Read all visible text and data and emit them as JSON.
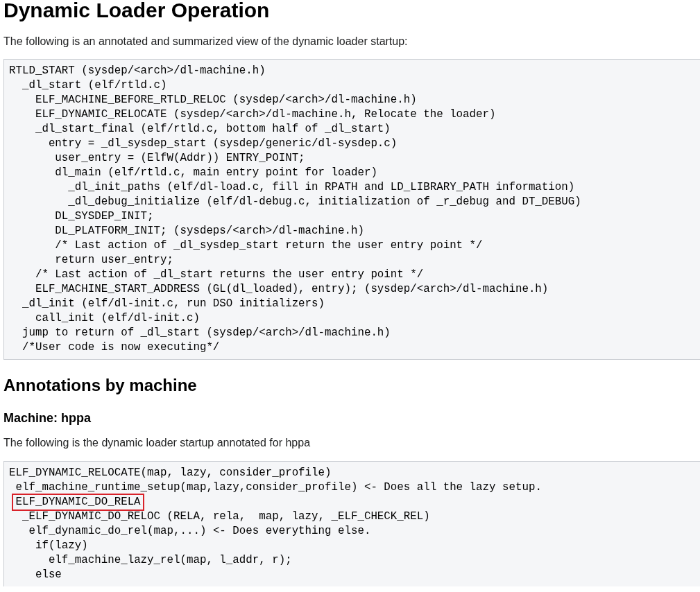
{
  "title": "Dynamic Loader Operation",
  "intro": "The following is an annotated and summarized view of the dynamic loader startup:",
  "code_block_1": {
    "lines": [
      {
        "text": "RTLD_START (sysdep/<arch>/dl-machine.h)"
      },
      {
        "text": "  _dl_start (elf/rtld.c)"
      },
      {
        "text": "    ELF_MACHINE_BEFORE_RTLD_RELOC (sysdep/<arch>/dl-machine.h)"
      },
      {
        "text": "    ELF_DYNAMIC_RELOCATE (sysdep/<arch>/dl-machine.h, Relocate the loader)"
      },
      {
        "text": "    _dl_start_final (elf/rtld.c, bottom half of _dl_start)"
      },
      {
        "text": "      entry = _dl_sysdep_start (sysdep/generic/dl-sysdep.c)"
      },
      {
        "text": "       user_entry = (ElfW(Addr)) ENTRY_POINT;"
      },
      {
        "text": "       dl_main (elf/rtld.c, main entry point for loader)"
      },
      {
        "text": "         _dl_init_paths (elf/dl-load.c, fill in RPATH and LD_LIBRARY_PATH information)"
      },
      {
        "text": "         _dl_debug_initialize (elf/dl-debug.c, initialization of _r_debug and DT_DEBUG)"
      },
      {
        "text": "       DL_SYSDEP_INIT;"
      },
      {
        "text": "       DL_PLATFORM_INIT; (sysdeps/<arch>/dl-machine.h)"
      },
      {
        "text": "       /* Last action of _dl_sysdep_start return the user entry point */"
      },
      {
        "text": "       return user_entry;"
      },
      {
        "text": "    /* Last action of _dl_start returns the user entry point */"
      },
      {
        "text": "    ELF_MACHINE_START_ADDRESS (GL(dl_loaded), entry); (sysdep/<arch>/dl-machine.h)"
      },
      {
        "text": "  _dl_init (elf/dl-init.c, run DSO initializers)"
      },
      {
        "text": "    call_init (elf/dl-init.c)"
      },
      {
        "text": "  jump to return of _dl_start (sysdep/<arch>/dl-machine.h)"
      },
      {
        "text": "  /*User code is now executing*/"
      }
    ]
  },
  "section_heading": "Annotations by machine",
  "machine_heading": "Machine: hppa",
  "machine_intro": "The following is the dynamic loader startup annotated for hppa",
  "code_block_2": {
    "lines": [
      {
        "text": "ELF_DYNAMIC_RELOCATE(map, lazy, consider_profile)",
        "highlighted": false
      },
      {
        "text": " elf_machine_runtime_setup(map,lazy,consider_profile) <- Does all the lazy setup.",
        "highlighted": false
      },
      {
        "text": " ELF_DYNAMIC_DO_RELA",
        "highlighted": true
      },
      {
        "text": "  _ELF_DYNAMIC_DO_RELOC (RELA, rela,  map, lazy, _ELF_CHECK_REL)",
        "highlighted": false
      },
      {
        "text": "   elf_dynamic_do_rel(map,...) <- Does everything else.",
        "highlighted": false
      },
      {
        "text": "    if(lazy)",
        "highlighted": false
      },
      {
        "text": "      elf_machine_lazy_rel(map, l_addr, r);",
        "highlighted": false
      },
      {
        "text": "    else",
        "highlighted": false
      }
    ]
  }
}
